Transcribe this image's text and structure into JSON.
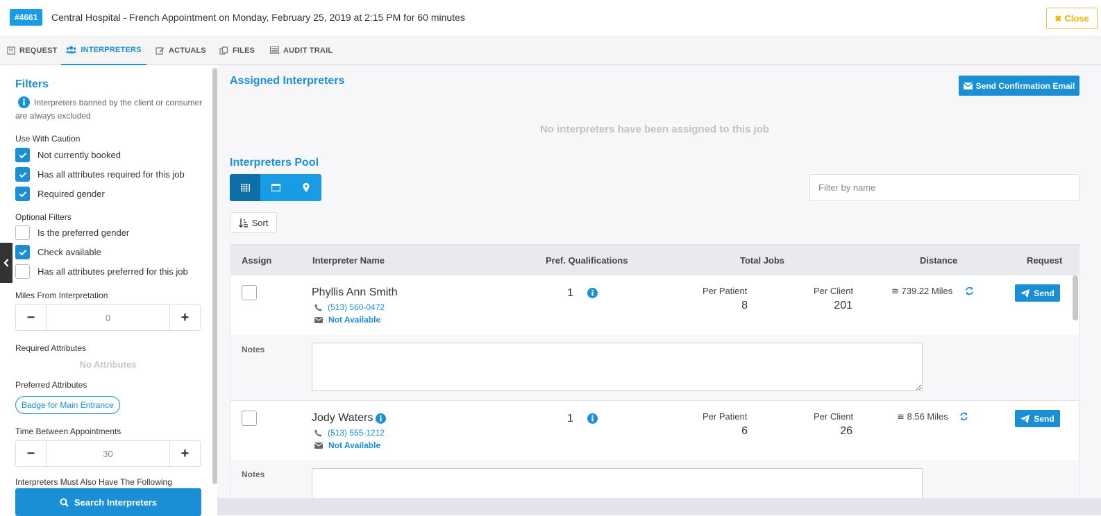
{
  "header": {
    "job_number": "#4661",
    "title": "Central Hospital  - French Appointment on Monday, February 25, 2019 at 2:15 PM for 60 minutes",
    "close_label": "Close"
  },
  "tabs": [
    {
      "label": "REQUEST",
      "icon": "request-doc-icon"
    },
    {
      "label": "INTERPRETERS",
      "icon": "users-icon",
      "active": true
    },
    {
      "label": "ACTUALS",
      "icon": "edit-icon"
    },
    {
      "label": "FILES",
      "icon": "files-icon"
    },
    {
      "label": "AUDIT TRAIL",
      "icon": "list-icon"
    }
  ],
  "filters": {
    "title": "Filters",
    "ban_note": "Interpreters banned by the client or consumer are always excluded",
    "caution_label": "Use With Caution",
    "caution": [
      {
        "label": "Not currently booked",
        "checked": true
      },
      {
        "label": "Has all attributes required for this job",
        "checked": true
      },
      {
        "label": "Required gender",
        "checked": true
      }
    ],
    "optional_label": "Optional Filters",
    "optional": [
      {
        "label": "Is the preferred gender",
        "checked": false
      },
      {
        "label": "Check available",
        "checked": true
      },
      {
        "label": "Has all attributes preferred for this job",
        "checked": false
      }
    ],
    "miles_label": "Miles From Interpretation",
    "miles_value": "0",
    "required_attr_label": "Required Attributes",
    "required_attr_empty": "No Attributes",
    "preferred_attr_label": "Preferred Attributes",
    "preferred_attr": "Badge for Main Entrance",
    "time_between_label": "Time Between Appointments",
    "time_between_value": "30",
    "must_have_label": "Interpreters Must Also Have The Following",
    "search_label": "Search Interpreters"
  },
  "assigned": {
    "title": "Assigned Interpreters",
    "send_email_label": "Send Confirmation Email",
    "empty_message": "No interpreters have been assigned to this job"
  },
  "pool": {
    "title": "Interpreters Pool",
    "filter_placeholder": "Filter by name",
    "sort_label": "Sort",
    "columns": {
      "assign": "Assign",
      "name": "Interpreter Name",
      "qual": "Pref. Qualifications",
      "total": "Total Jobs",
      "distance": "Distance",
      "request": "Request"
    },
    "per_patient_label": "Per Patient",
    "per_client_label": "Per Client",
    "notes_label": "Notes",
    "send_label": "Send",
    "rows": [
      {
        "name": "Phyllis Ann Smith",
        "phone": "(513) 560-0472",
        "email_status": "Not Available",
        "qual": "1",
        "per_patient": "8",
        "per_client": "201",
        "distance": "≅ 739.22 Miles"
      },
      {
        "name": "Jody Waters",
        "phone": "(513) 555-1212",
        "email_status": "Not Available",
        "qual": "1",
        "per_patient": "6",
        "per_client": "26",
        "distance": "≅ 8.56 Miles"
      }
    ]
  },
  "colors": {
    "accent": "#1a8fd6",
    "warning": "#f0b400"
  }
}
